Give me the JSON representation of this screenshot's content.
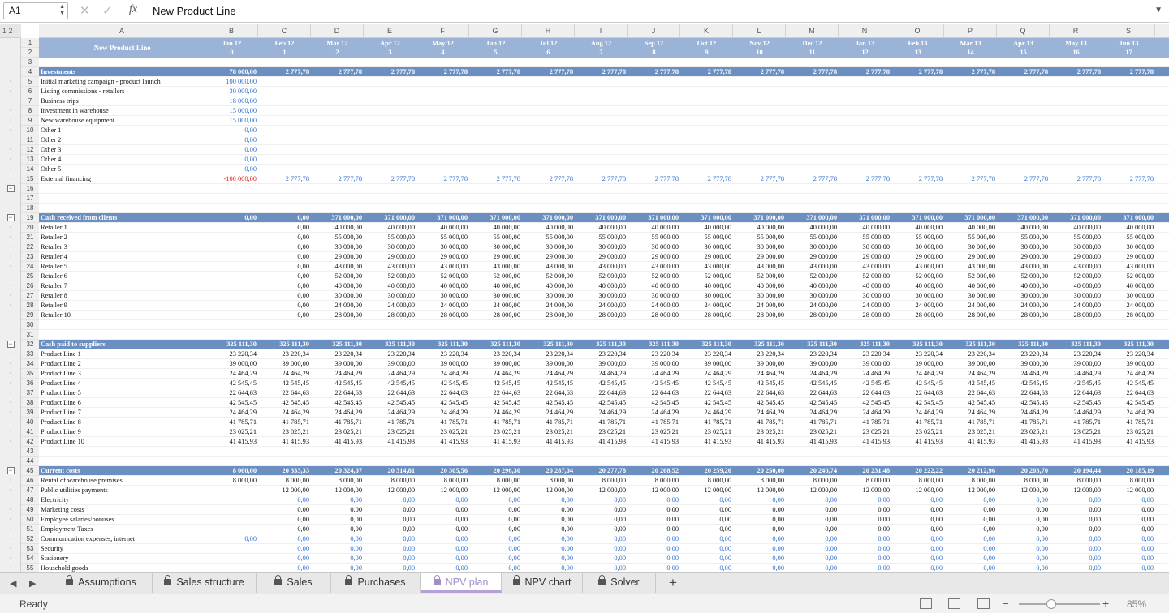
{
  "formula_bar": {
    "cell_ref": "A1",
    "fx": "fx",
    "value": "New Product Line"
  },
  "outline_levels": [
    "1",
    "2"
  ],
  "columns": [
    "A",
    "B",
    "C",
    "D",
    "E",
    "F",
    "G",
    "H",
    "I",
    "J",
    "K",
    "L",
    "M",
    "N",
    "O",
    "P",
    "Q",
    "R",
    "S"
  ],
  "title": "New Product Line",
  "months": [
    {
      "m": "Jan 12",
      "i": "0"
    },
    {
      "m": "Feb 12",
      "i": "1"
    },
    {
      "m": "Mar 12",
      "i": "2"
    },
    {
      "m": "Apr 12",
      "i": "3"
    },
    {
      "m": "May 12",
      "i": "4"
    },
    {
      "m": "Jun 12",
      "i": "5"
    },
    {
      "m": "Jul 12",
      "i": "6"
    },
    {
      "m": "Aug 12",
      "i": "7"
    },
    {
      "m": "Sep 12",
      "i": "8"
    },
    {
      "m": "Oct 12",
      "i": "9"
    },
    {
      "m": "Nov 12",
      "i": "10"
    },
    {
      "m": "Dec 12",
      "i": "11"
    },
    {
      "m": "Jan 13",
      "i": "12"
    },
    {
      "m": "Feb 13",
      "i": "13"
    },
    {
      "m": "Mar 13",
      "i": "14"
    },
    {
      "m": "Apr 13",
      "i": "15"
    },
    {
      "m": "May 13",
      "i": "16"
    },
    {
      "m": "Jun 13",
      "i": "17"
    }
  ],
  "rows": [
    {
      "r": "3",
      "label": "",
      "b": "",
      "c": "",
      "rest": ""
    },
    {
      "r": "4",
      "label": "Investments",
      "b": "78 000,00",
      "c": "2 777,78",
      "rest": "2 777,78",
      "hdr": true
    },
    {
      "r": "5",
      "label": "Initial marketing campaign - product launch",
      "b": "100 000,00",
      "bc": "bl",
      "c": "",
      "rest": ""
    },
    {
      "r": "6",
      "label": "Listing commissions - retailers",
      "b": "30 000,00",
      "bc": "bl",
      "c": "",
      "rest": ""
    },
    {
      "r": "7",
      "label": "Business trips",
      "b": "18 000,00",
      "bc": "bl",
      "c": "",
      "rest": ""
    },
    {
      "r": "8",
      "label": "Investment in warehouse",
      "b": "15 000,00",
      "bc": "bl",
      "c": "",
      "rest": ""
    },
    {
      "r": "9",
      "label": "New warehouse equipment",
      "b": "15 000,00",
      "bc": "bl",
      "c": "",
      "rest": ""
    },
    {
      "r": "10",
      "label": "Other 1",
      "b": "0,00",
      "bc": "bl",
      "c": "",
      "rest": ""
    },
    {
      "r": "11",
      "label": "Other 2",
      "b": "0,00",
      "bc": "bl",
      "c": "",
      "rest": ""
    },
    {
      "r": "12",
      "label": "Other 3",
      "b": "0,00",
      "bc": "bl",
      "c": "",
      "rest": ""
    },
    {
      "r": "13",
      "label": "Other 4",
      "b": "0,00",
      "bc": "bl",
      "c": "",
      "rest": ""
    },
    {
      "r": "14",
      "label": "Other 5",
      "b": "0,00",
      "bc": "bl",
      "c": "",
      "rest": ""
    },
    {
      "r": "15",
      "label": "External financing",
      "b": "-100 000,00",
      "bc": "rd",
      "c": "2 777,78",
      "rest": "2 777,78",
      "cc": "bl"
    },
    {
      "r": "16",
      "label": "",
      "b": "",
      "c": "",
      "rest": ""
    },
    {
      "r": "17",
      "label": "",
      "b": "",
      "c": "",
      "rest": ""
    },
    {
      "r": "18",
      "label": "",
      "b": "",
      "c": "",
      "rest": ""
    },
    {
      "r": "19",
      "label": "Cash received from clients",
      "b": "0,00",
      "c": "0,00",
      "rest": "371 000,00",
      "hdr": true
    },
    {
      "r": "20",
      "label": "Retailer 1",
      "b": "",
      "c": "0,00",
      "rest": "40 000,00"
    },
    {
      "r": "21",
      "label": "Retailer 2",
      "b": "",
      "c": "0,00",
      "rest": "55 000,00"
    },
    {
      "r": "22",
      "label": "Retailer 3",
      "b": "",
      "c": "0,00",
      "rest": "30 000,00"
    },
    {
      "r": "23",
      "label": "Retailer 4",
      "b": "",
      "c": "0,00",
      "rest": "29 000,00"
    },
    {
      "r": "24",
      "label": "Retailer 5",
      "b": "",
      "c": "0,00",
      "rest": "43 000,00"
    },
    {
      "r": "25",
      "label": "Retailer 6",
      "b": "",
      "c": "0,00",
      "rest": "52 000,00"
    },
    {
      "r": "26",
      "label": "Retailer 7",
      "b": "",
      "c": "0,00",
      "rest": "40 000,00"
    },
    {
      "r": "27",
      "label": "Retailer 8",
      "b": "",
      "c": "0,00",
      "rest": "30 000,00"
    },
    {
      "r": "28",
      "label": "Retailer 9",
      "b": "",
      "c": "0,00",
      "rest": "24 000,00"
    },
    {
      "r": "29",
      "label": "Retailer 10",
      "b": "",
      "c": "0,00",
      "rest": "28 000,00"
    },
    {
      "r": "30",
      "label": "",
      "b": "",
      "c": "",
      "rest": ""
    },
    {
      "r": "31",
      "label": "",
      "b": "",
      "c": "",
      "rest": ""
    },
    {
      "r": "32",
      "label": "Cash paid to suppliers",
      "b": "325 111,30",
      "c": "325 111,30",
      "rest": "325 111,30",
      "hdr": true
    },
    {
      "r": "33",
      "label": "Product Line 1",
      "b": "23 220,34",
      "c": "23 220,34",
      "rest": "23 220,34"
    },
    {
      "r": "34",
      "label": "Product Line 2",
      "b": "39 000,00",
      "c": "39 000,00",
      "rest": "39 000,00"
    },
    {
      "r": "35",
      "label": "Product Line 3",
      "b": "24 464,29",
      "c": "24 464,29",
      "rest": "24 464,29"
    },
    {
      "r": "36",
      "label": "Product Line 4",
      "b": "42 545,45",
      "c": "42 545,45",
      "rest": "42 545,45"
    },
    {
      "r": "37",
      "label": "Product Line 5",
      "b": "22 644,63",
      "c": "22 644,63",
      "rest": "22 644,63"
    },
    {
      "r": "38",
      "label": "Product Line 6",
      "b": "42 545,45",
      "c": "42 545,45",
      "rest": "42 545,45"
    },
    {
      "r": "39",
      "label": "Product Line 7",
      "b": "24 464,29",
      "c": "24 464,29",
      "rest": "24 464,29"
    },
    {
      "r": "40",
      "label": "Product Line 8",
      "b": "41 785,71",
      "c": "41 785,71",
      "rest": "41 785,71"
    },
    {
      "r": "41",
      "label": "Product Line 9",
      "b": "23 025,21",
      "c": "23 025,21",
      "rest": "23 025,21"
    },
    {
      "r": "42",
      "label": "Product Line 10",
      "b": "41 415,93",
      "c": "41 415,93",
      "rest": "41 415,93"
    },
    {
      "r": "43",
      "label": "",
      "b": "",
      "c": "",
      "rest": ""
    },
    {
      "r": "44",
      "label": "",
      "b": "",
      "c": "",
      "rest": ""
    },
    {
      "r": "45",
      "label": "Current costs",
      "b": "8 000,00",
      "c": "20 333,33",
      "rest": "",
      "hdr": true
    },
    {
      "r": "46",
      "label": "Rental of warehouse premises",
      "b": "8 000,00",
      "c": "8 000,00",
      "rest": "8 000,00"
    },
    {
      "r": "47",
      "label": "Public utilities payments",
      "b": "",
      "c": "12 000,00",
      "rest": "12 000,00"
    },
    {
      "r": "48",
      "label": "Electricity",
      "b": "",
      "c": "0,00",
      "rest": "0,00",
      "cc": "bl"
    },
    {
      "r": "49",
      "label": "Marketing costs",
      "b": "",
      "c": "0,00",
      "rest": "0,00"
    },
    {
      "r": "50",
      "label": "Employee salaries/bonuses",
      "b": "",
      "c": "0,00",
      "rest": "0,00"
    },
    {
      "r": "51",
      "label": "Employment Taxes",
      "b": "",
      "c": "0,00",
      "rest": "0,00"
    },
    {
      "r": "52",
      "label": "Communication expenses, internet",
      "b": "0,00",
      "bc": "bl",
      "c": "0,00",
      "rest": "0,00",
      "cc": "bl"
    },
    {
      "r": "53",
      "label": "Security",
      "b": "",
      "c": "0,00",
      "rest": "0,00",
      "cc": "bl"
    },
    {
      "r": "54",
      "label": "Stationery",
      "b": "",
      "c": "0,00",
      "rest": "0,00",
      "cc": "bl"
    },
    {
      "r": "55",
      "label": "Household goods",
      "b": "",
      "c": "0,00",
      "rest": "0,00",
      "cc": "bl"
    }
  ],
  "current_costs_totals": [
    "20 333,33",
    "20 324,07",
    "20 314,81",
    "20 305,56",
    "20 296,30",
    "20 287,04",
    "20 277,78",
    "20 268,52",
    "20 259,26",
    "20 250,00",
    "20 240,74",
    "20 231,48",
    "20 222,22",
    "20 212,96",
    "20 203,70",
    "20 194,44",
    "20 185,19"
  ],
  "tabs": [
    "Assumptions",
    "Sales structure",
    "Sales",
    "Purchases",
    "NPV plan",
    "NPV chart",
    "Solver"
  ],
  "active_tab": "NPV plan",
  "status": {
    "ready": "Ready",
    "zoom": "85%"
  }
}
